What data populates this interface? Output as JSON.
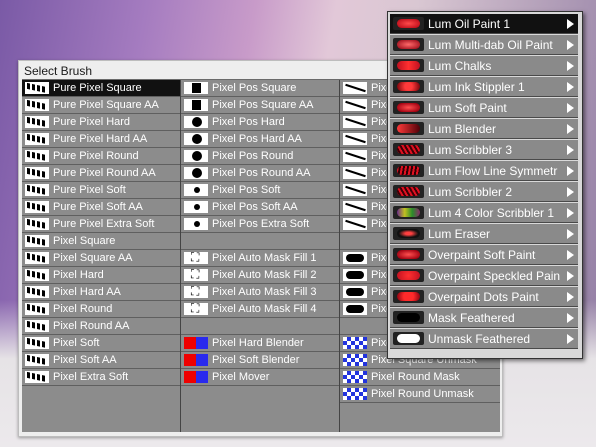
{
  "window": {
    "title": "Select Brush"
  },
  "columns": [
    {
      "rows": [
        {
          "label": "Pure Pixel Square",
          "icon": "pixel-brush-icon",
          "selected": true
        },
        {
          "label": "Pure Pixel Square AA",
          "icon": "pixel-brush-icon"
        },
        {
          "label": "Pure Pixel Hard",
          "icon": "pixel-brush-icon"
        },
        {
          "label": "Pure Pixel Hard AA",
          "icon": "pixel-brush-icon"
        },
        {
          "label": "Pure Pixel Round",
          "icon": "pixel-brush-icon"
        },
        {
          "label": "Pure Pixel Round AA",
          "icon": "pixel-brush-icon"
        },
        {
          "label": "Pure Pixel Soft",
          "icon": "pixel-brush-icon"
        },
        {
          "label": "Pure Pixel Soft AA",
          "icon": "pixel-brush-icon"
        },
        {
          "label": "Pure Pixel Extra Soft",
          "icon": "pixel-brush-icon"
        },
        {
          "label": "Pixel Square",
          "icon": "pixel-brush-icon"
        },
        {
          "label": "Pixel Square AA",
          "icon": "pixel-brush-icon"
        },
        {
          "label": "Pixel Hard",
          "icon": "pixel-brush-icon"
        },
        {
          "label": "Pixel Hard AA",
          "icon": "pixel-brush-icon"
        },
        {
          "label": "Pixel Round",
          "icon": "pixel-brush-icon"
        },
        {
          "label": "Pixel Round AA",
          "icon": "pixel-brush-icon"
        },
        {
          "label": "Pixel Soft",
          "icon": "pixel-brush-icon"
        },
        {
          "label": "Pixel Soft AA",
          "icon": "pixel-brush-icon"
        },
        {
          "label": "Pixel Extra Soft",
          "icon": "pixel-brush-icon"
        }
      ]
    },
    {
      "rows": [
        {
          "label": "Pixel Pos Square",
          "icon": "square-brush-icon"
        },
        {
          "label": "Pixel Pos Square AA",
          "icon": "square-brush-icon"
        },
        {
          "label": "Pixel Pos Hard",
          "icon": "round-brush-icon"
        },
        {
          "label": "Pixel Pos Hard AA",
          "icon": "round-brush-icon"
        },
        {
          "label": "Pixel Pos Round",
          "icon": "round-brush-icon"
        },
        {
          "label": "Pixel Pos Round AA",
          "icon": "round-brush-icon"
        },
        {
          "label": "Pixel Pos Soft",
          "icon": "small-dot-brush-icon"
        },
        {
          "label": "Pixel Pos Soft AA",
          "icon": "small-dot-brush-icon"
        },
        {
          "label": "Pixel Pos Extra Soft",
          "icon": "small-dot-brush-icon"
        },
        {
          "label": "",
          "icon": ""
        },
        {
          "label": "Pixel Auto Mask Fill 1",
          "icon": "fill-bucket-icon"
        },
        {
          "label": "Pixel Auto Mask Fill 2",
          "icon": "fill-bucket-icon"
        },
        {
          "label": "Pixel Auto Mask Fill 3",
          "icon": "fill-bucket-icon"
        },
        {
          "label": "Pixel Auto Mask Fill 4",
          "icon": "fill-bucket-icon"
        },
        {
          "label": "",
          "icon": ""
        },
        {
          "label": "Pixel Hard Blender",
          "icon": "blender-icon"
        },
        {
          "label": "Pixel Soft Blender",
          "icon": "blender-icon"
        },
        {
          "label": "Pixel Mover",
          "icon": "blender-icon"
        }
      ]
    },
    {
      "rows": [
        {
          "label": "Pixel",
          "icon": "line-brush-icon"
        },
        {
          "label": "Pixel",
          "icon": "line-brush-icon"
        },
        {
          "label": "Pixel",
          "icon": "line-brush-icon"
        },
        {
          "label": "Pixel",
          "icon": "line-brush-icon"
        },
        {
          "label": "Pixel",
          "icon": "line-brush-icon"
        },
        {
          "label": "Pixel",
          "icon": "line-brush-icon"
        },
        {
          "label": "Pixel",
          "icon": "line-brush-icon"
        },
        {
          "label": "Pixel",
          "icon": "line-brush-icon"
        },
        {
          "label": "Pixel",
          "icon": "line-brush-icon"
        },
        {
          "label": "",
          "icon": ""
        },
        {
          "label": "Pixel",
          "icon": "blob-brush-icon"
        },
        {
          "label": "Pixel",
          "icon": "blob-brush-icon"
        },
        {
          "label": "Pixel",
          "icon": "blob-brush-icon"
        },
        {
          "label": "Pixel",
          "icon": "blob-brush-icon"
        },
        {
          "label": "",
          "icon": ""
        },
        {
          "label": "Pixel",
          "icon": "checker-brush-icon"
        },
        {
          "label": "Pixel Square Unmask",
          "icon": "checker-brush-icon"
        },
        {
          "label": "Pixel Round Mask",
          "icon": "checker-brush-icon"
        },
        {
          "label": "Pixel Round Unmask",
          "icon": "checker-brush-icon"
        }
      ]
    }
  ],
  "menu": {
    "items": [
      {
        "label": "Lum Oil Paint 1",
        "icon": "red-oil-swatch",
        "highlighted": true
      },
      {
        "label": "Lum Multi-dab Oil Paint",
        "icon": "red-multidab-swatch"
      },
      {
        "label": "Lum Chalks",
        "icon": "red-chalk-swatch"
      },
      {
        "label": "Lum Ink Stippler 1",
        "icon": "red-stipple-swatch"
      },
      {
        "label": "Lum Soft Paint",
        "icon": "red-soft-swatch"
      },
      {
        "label": "Lum Blender",
        "icon": "red-blender-swatch"
      },
      {
        "label": "Lum Scribbler 3",
        "icon": "red-scribble-swatch"
      },
      {
        "label": "Lum Flow Line Symmetr",
        "icon": "red-flow-swatch"
      },
      {
        "label": "Lum Scribbler 2",
        "icon": "red-scribble-swatch"
      },
      {
        "label": "Lum 4 Color Scribbler 1",
        "icon": "multicolor-scribble-swatch"
      },
      {
        "label": "Lum Eraser",
        "icon": "eraser-swatch"
      },
      {
        "label": "Overpaint Soft Paint",
        "icon": "red-soft-swatch"
      },
      {
        "label": "Overpaint Speckled Pain",
        "icon": "red-speckle-swatch"
      },
      {
        "label": "Overpaint Dots Paint",
        "icon": "red-dots-swatch"
      },
      {
        "label": "Mask Feathered",
        "icon": "black-stroke-swatch"
      },
      {
        "label": "Unmask Feathered",
        "icon": "white-stroke-swatch"
      }
    ]
  },
  "colors": {
    "accent": "#e0101a",
    "highlight": "#111111",
    "cell": "#8c8c8c"
  }
}
